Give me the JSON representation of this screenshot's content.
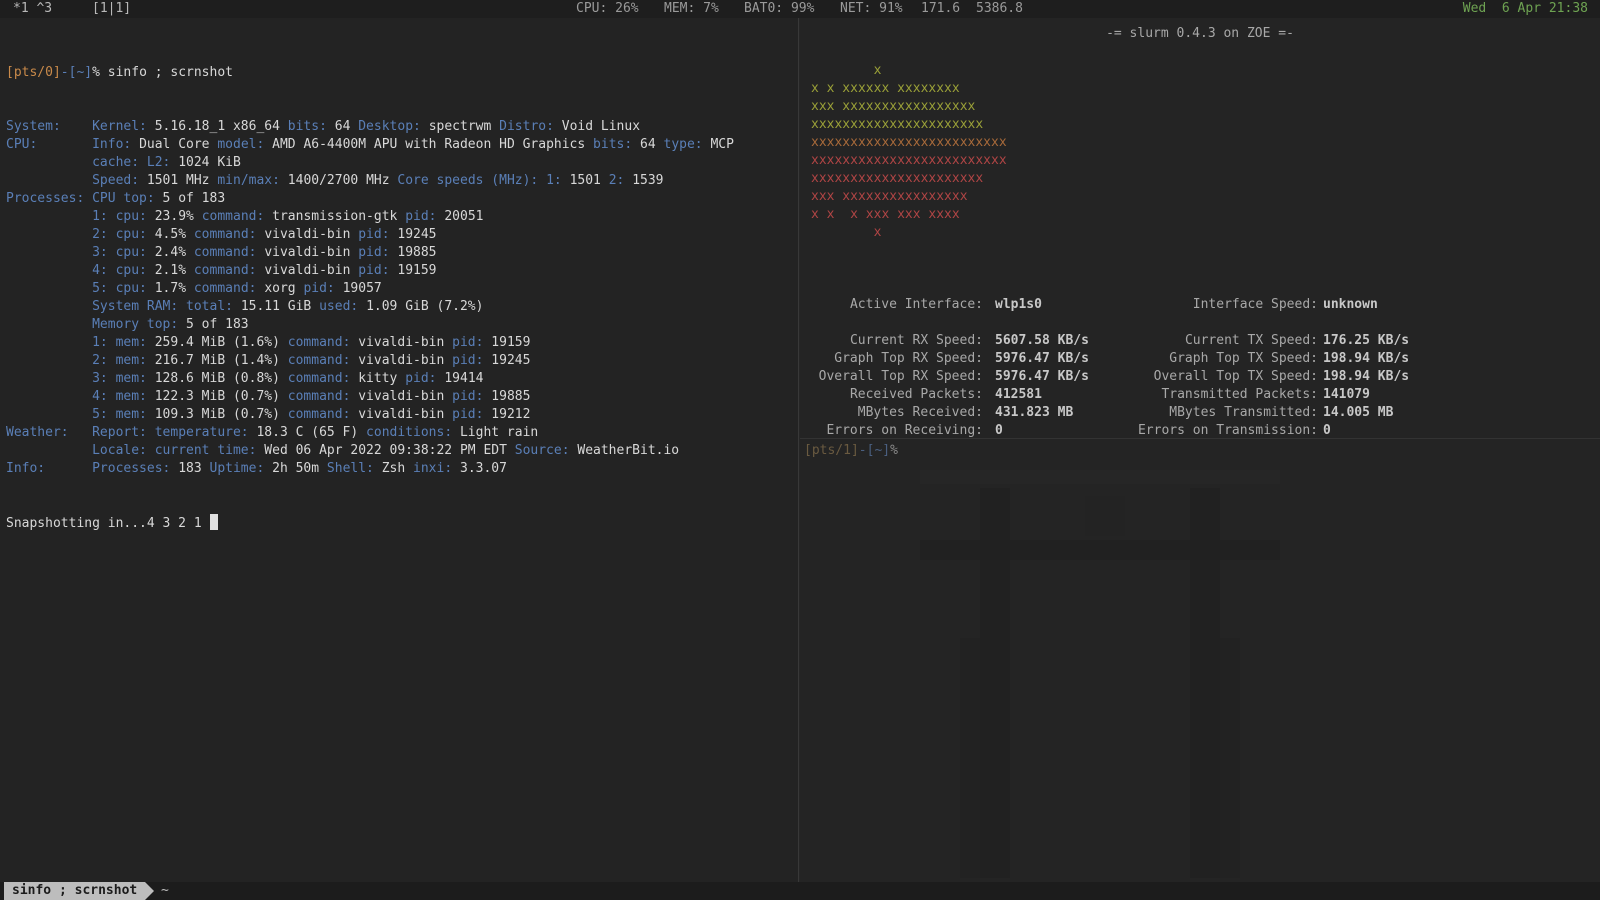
{
  "topbar": {
    "workspaces": "*1 ^3",
    "layout": "[1|1]",
    "cpu": "CPU: 26%",
    "mem": "MEM: 7%",
    "bat": "BAT0: 99%",
    "net": "NET: 91%",
    "rx": "171.6",
    "tx": "5386.8",
    "clock": "Wed  6 Apr 21:38"
  },
  "left": {
    "prompt": {
      "tty": "[pts/0]",
      "sep": "-",
      "dir": "[~]",
      "sym": "% ",
      "cmd": "sinfo ; scrnshot"
    },
    "lines": [
      [
        [
          "lbl",
          "System:    "
        ],
        [
          "lbl",
          "Kernel: "
        ],
        [
          "val",
          "5.16.18_1 x86_64 "
        ],
        [
          "lbl",
          "bits: "
        ],
        [
          "val",
          "64 "
        ],
        [
          "lbl",
          "Desktop: "
        ],
        [
          "val",
          "spectrwm "
        ],
        [
          "lbl",
          "Distro: "
        ],
        [
          "val",
          "Void Linux"
        ]
      ],
      [
        [
          "lbl",
          "CPU:       "
        ],
        [
          "lbl",
          "Info: "
        ],
        [
          "val",
          "Dual Core "
        ],
        [
          "lbl",
          "model: "
        ],
        [
          "val",
          "AMD A6-4400M APU with Radeon HD Graphics "
        ],
        [
          "lbl",
          "bits: "
        ],
        [
          "val",
          "64 "
        ],
        [
          "lbl",
          "type: "
        ],
        [
          "val",
          "MCP"
        ]
      ],
      [
        [
          "val",
          "           "
        ],
        [
          "lbl",
          "cache: "
        ],
        [
          "lbl",
          "L2: "
        ],
        [
          "val",
          "1024 KiB"
        ]
      ],
      [
        [
          "val",
          "           "
        ],
        [
          "lbl",
          "Speed: "
        ],
        [
          "val",
          "1501 MHz "
        ],
        [
          "lbl",
          "min/max: "
        ],
        [
          "val",
          "1400/2700 MHz "
        ],
        [
          "lbl",
          "Core speeds (MHz): "
        ],
        [
          "lbl",
          "1: "
        ],
        [
          "val",
          "1501 "
        ],
        [
          "lbl",
          "2: "
        ],
        [
          "val",
          "1539"
        ]
      ],
      [
        [
          "lbl",
          "Processes: "
        ],
        [
          "lbl",
          "CPU top: "
        ],
        [
          "val",
          "5 of 183"
        ]
      ],
      [
        [
          "val",
          "           "
        ],
        [
          "lbl",
          "1: "
        ],
        [
          "lbl",
          "cpu: "
        ],
        [
          "val",
          "23.9% "
        ],
        [
          "lbl",
          "command: "
        ],
        [
          "val",
          "transmission-gtk "
        ],
        [
          "lbl",
          "pid: "
        ],
        [
          "val",
          "20051"
        ]
      ],
      [
        [
          "val",
          "           "
        ],
        [
          "lbl",
          "2: "
        ],
        [
          "lbl",
          "cpu: "
        ],
        [
          "val",
          "4.5% "
        ],
        [
          "lbl",
          "command: "
        ],
        [
          "val",
          "vivaldi-bin "
        ],
        [
          "lbl",
          "pid: "
        ],
        [
          "val",
          "19245"
        ]
      ],
      [
        [
          "val",
          "           "
        ],
        [
          "lbl",
          "3: "
        ],
        [
          "lbl",
          "cpu: "
        ],
        [
          "val",
          "2.4% "
        ],
        [
          "lbl",
          "command: "
        ],
        [
          "val",
          "vivaldi-bin "
        ],
        [
          "lbl",
          "pid: "
        ],
        [
          "val",
          "19885"
        ]
      ],
      [
        [
          "val",
          "           "
        ],
        [
          "lbl",
          "4: "
        ],
        [
          "lbl",
          "cpu: "
        ],
        [
          "val",
          "2.1% "
        ],
        [
          "lbl",
          "command: "
        ],
        [
          "val",
          "vivaldi-bin "
        ],
        [
          "lbl",
          "pid: "
        ],
        [
          "val",
          "19159"
        ]
      ],
      [
        [
          "val",
          "           "
        ],
        [
          "lbl",
          "5: "
        ],
        [
          "lbl",
          "cpu: "
        ],
        [
          "val",
          "1.7% "
        ],
        [
          "lbl",
          "command: "
        ],
        [
          "val",
          "xorg "
        ],
        [
          "lbl",
          "pid: "
        ],
        [
          "val",
          "19057"
        ]
      ],
      [
        [
          "val",
          "           "
        ],
        [
          "lbl",
          "System RAM: "
        ],
        [
          "lbl",
          "total: "
        ],
        [
          "val",
          "15.11 GiB "
        ],
        [
          "lbl",
          "used: "
        ],
        [
          "val",
          "1.09 GiB (7.2%)"
        ]
      ],
      [
        [
          "val",
          "           "
        ],
        [
          "lbl",
          "Memory top: "
        ],
        [
          "val",
          "5 of 183"
        ]
      ],
      [
        [
          "val",
          "           "
        ],
        [
          "lbl",
          "1: "
        ],
        [
          "lbl",
          "mem: "
        ],
        [
          "val",
          "259.4 MiB (1.6%) "
        ],
        [
          "lbl",
          "command: "
        ],
        [
          "val",
          "vivaldi-bin "
        ],
        [
          "lbl",
          "pid: "
        ],
        [
          "val",
          "19159"
        ]
      ],
      [
        [
          "val",
          "           "
        ],
        [
          "lbl",
          "2: "
        ],
        [
          "lbl",
          "mem: "
        ],
        [
          "val",
          "216.7 MiB (1.4%) "
        ],
        [
          "lbl",
          "command: "
        ],
        [
          "val",
          "vivaldi-bin "
        ],
        [
          "lbl",
          "pid: "
        ],
        [
          "val",
          "19245"
        ]
      ],
      [
        [
          "val",
          "           "
        ],
        [
          "lbl",
          "3: "
        ],
        [
          "lbl",
          "mem: "
        ],
        [
          "val",
          "128.6 MiB (0.8%) "
        ],
        [
          "lbl",
          "command: "
        ],
        [
          "val",
          "kitty "
        ],
        [
          "lbl",
          "pid: "
        ],
        [
          "val",
          "19414"
        ]
      ],
      [
        [
          "val",
          "           "
        ],
        [
          "lbl",
          "4: "
        ],
        [
          "lbl",
          "mem: "
        ],
        [
          "val",
          "122.3 MiB (0.7%) "
        ],
        [
          "lbl",
          "command: "
        ],
        [
          "val",
          "vivaldi-bin "
        ],
        [
          "lbl",
          "pid: "
        ],
        [
          "val",
          "19885"
        ]
      ],
      [
        [
          "val",
          "           "
        ],
        [
          "lbl",
          "5: "
        ],
        [
          "lbl",
          "mem: "
        ],
        [
          "val",
          "109.3 MiB (0.7%) "
        ],
        [
          "lbl",
          "command: "
        ],
        [
          "val",
          "vivaldi-bin "
        ],
        [
          "lbl",
          "pid: "
        ],
        [
          "val",
          "19212"
        ]
      ],
      [
        [
          "lbl",
          "Weather:   "
        ],
        [
          "lbl",
          "Report: "
        ],
        [
          "lbl",
          "temperature: "
        ],
        [
          "val",
          "18.3 C (65 F) "
        ],
        [
          "lbl",
          "conditions: "
        ],
        [
          "val",
          "Light rain"
        ]
      ],
      [
        [
          "val",
          "           "
        ],
        [
          "lbl",
          "Locale: "
        ],
        [
          "lbl",
          "current time: "
        ],
        [
          "val",
          "Wed 06 Apr 2022 09:38:22 PM EDT "
        ],
        [
          "lbl",
          "Source: "
        ],
        [
          "val",
          "WeatherBit.io"
        ]
      ],
      [
        [
          "lbl",
          "Info:      "
        ],
        [
          "lbl",
          "Processes: "
        ],
        [
          "val",
          "183 "
        ],
        [
          "lbl",
          "Uptime: "
        ],
        [
          "val",
          "2h 50m "
        ],
        [
          "lbl",
          "Shell: "
        ],
        [
          "val",
          "Zsh "
        ],
        [
          "lbl",
          "inxi: "
        ],
        [
          "val",
          "3.3.07"
        ]
      ]
    ],
    "snapshot": "Snapshotting in...4 3 2 1 "
  },
  "right": {
    "title": "-= slurm 0.4.3 on ZOE =-",
    "graph": [
      [
        "g-hi",
        "        x"
      ],
      [
        "g-hi",
        "x x xxxxxx xxxxxxxx"
      ],
      [
        "g-hi",
        "xxx xxxxxxxxxxxxxxxxx"
      ],
      [
        "g-hi",
        "xxxxxxxxxxxxxxxxxxxxxx"
      ],
      [
        "g-mid",
        "xxxxxxxxxxxxxxxxxxxxxxxxx"
      ],
      [
        "g-lo",
        "xxxxxxxxxxxxxxxxxxxxxxxxx"
      ],
      [
        "g-lo",
        "xxxxxxxxxxxxxxxxxxxxxx"
      ],
      [
        "g-lo",
        "xxx xxxxxxxxxxxxxxxx"
      ],
      [
        "g-lo",
        "x x  x xxx xxx xxxx"
      ],
      [
        "g-lo",
        "        x"
      ]
    ],
    "stats": [
      {
        "k1": "Active Interface:",
        "v1": "wlp1s0",
        "k2": "Interface Speed:",
        "v2": "unknown"
      },
      {
        "k1": "",
        "v1": "",
        "k2": "",
        "v2": ""
      },
      {
        "k1": "Current RX Speed:",
        "v1": "5607.58 KB/s",
        "k2": "Current TX Speed:",
        "v2": "176.25 KB/s"
      },
      {
        "k1": "Graph Top RX Speed:",
        "v1": "5976.47 KB/s",
        "k2": "Graph Top TX Speed:",
        "v2": "198.94 KB/s"
      },
      {
        "k1": "Overall Top RX Speed:",
        "v1": "5976.47 KB/s",
        "k2": "Overall Top TX Speed:",
        "v2": "198.94 KB/s"
      },
      {
        "k1": "Received Packets:",
        "v1": "412581",
        "k2": "Transmitted Packets:",
        "v2": "141079"
      },
      {
        "k1": "MBytes Received:",
        "v1": "431.823 MB",
        "k2": "MBytes Transmitted:",
        "v2": "14.005 MB"
      },
      {
        "k1": "Errors on Receiving:",
        "v1": "0",
        "k2": "Errors on Transmission:",
        "v2": "0"
      }
    ],
    "prompt": {
      "tty": "[pts/1]",
      "sep": "-",
      "dir": "[~]",
      "sym": "%"
    }
  },
  "statusbar": {
    "command": "sinfo ; scrnshot",
    "dir": "~"
  }
}
